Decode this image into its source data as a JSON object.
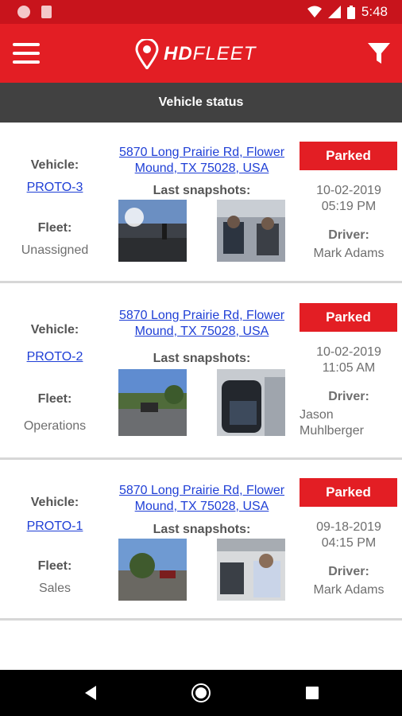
{
  "status_bar": {
    "time": "5:48"
  },
  "app": {
    "brand_prefix": "HD",
    "brand_suffix": "FLEET"
  },
  "subheader": "Vehicle status",
  "labels": {
    "vehicle": "Vehicle:",
    "fleet": "Fleet:",
    "last_snapshots": "Last snapshots:",
    "driver": "Driver:"
  },
  "vehicles": [
    {
      "name": "PROTO-3",
      "fleet": "Unassigned",
      "address_line1": "5870 Long Prairie Rd, Flower",
      "address_line2": "Mound, TX 75028, USA",
      "status": "Parked",
      "date": "10-02-2019",
      "time": "05:19 PM",
      "driver_line1": "Mark Adams",
      "driver_line2": ""
    },
    {
      "name": "PROTO-2",
      "fleet": "Operations",
      "address_line1": "5870 Long Prairie Rd, Flower",
      "address_line2": "Mound, TX 75028, USA",
      "status": "Parked",
      "date": "10-02-2019",
      "time": "11:05 AM",
      "driver_line1": "Jason",
      "driver_line2": "Muhlberger"
    },
    {
      "name": "PROTO-1",
      "fleet": "Sales",
      "address_line1": "5870 Long Prairie Rd, Flower",
      "address_line2": "Mound, TX 75028, USA",
      "status": "Parked",
      "date": "09-18-2019",
      "time": "04:15 PM",
      "driver_line1": "Mark Adams",
      "driver_line2": ""
    }
  ],
  "colors": {
    "brand_red": "#e31e24",
    "status_red": "#c8141c",
    "link_blue": "#1f3fd6"
  }
}
